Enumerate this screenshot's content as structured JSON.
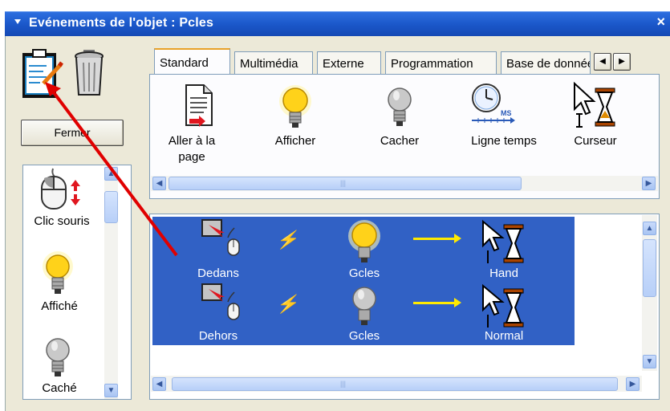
{
  "window": {
    "title": "Evénements de l'objet : Pcles",
    "close_glyph": "×"
  },
  "toolbar": {
    "close_button_label": "Fermer"
  },
  "tabs": [
    {
      "label": "Standard",
      "active": true
    },
    {
      "label": "Multimédia"
    },
    {
      "label": "Externe"
    },
    {
      "label": "Programmation"
    },
    {
      "label": "Base de donnée"
    }
  ],
  "actions": [
    {
      "label": "Aller à la page",
      "icon": "document-goto-icon"
    },
    {
      "label": "Afficher",
      "icon": "lightbulb-on-icon"
    },
    {
      "label": "Cacher",
      "icon": "lightbulb-off-icon"
    },
    {
      "label": "Ligne temps",
      "icon": "timeline-clock-icon"
    },
    {
      "label": "Curseur",
      "icon": "cursor-hourglass-icon"
    }
  ],
  "event_types": [
    {
      "label": "Clic souris",
      "icon": "mouse-click-icon"
    },
    {
      "label": "Affiché",
      "icon": "lightbulb-on-icon"
    },
    {
      "label": "Caché",
      "icon": "lightbulb-off-icon"
    }
  ],
  "events": [
    {
      "trigger": "Dedans",
      "target": "Gcles",
      "result": "Hand"
    },
    {
      "trigger": "Dehors",
      "target": "Gcles",
      "result": "Normal"
    }
  ],
  "colors": {
    "title_bar": "#1a56c8",
    "selection": "#3161c5",
    "annotation_arrow": "#e00000"
  }
}
